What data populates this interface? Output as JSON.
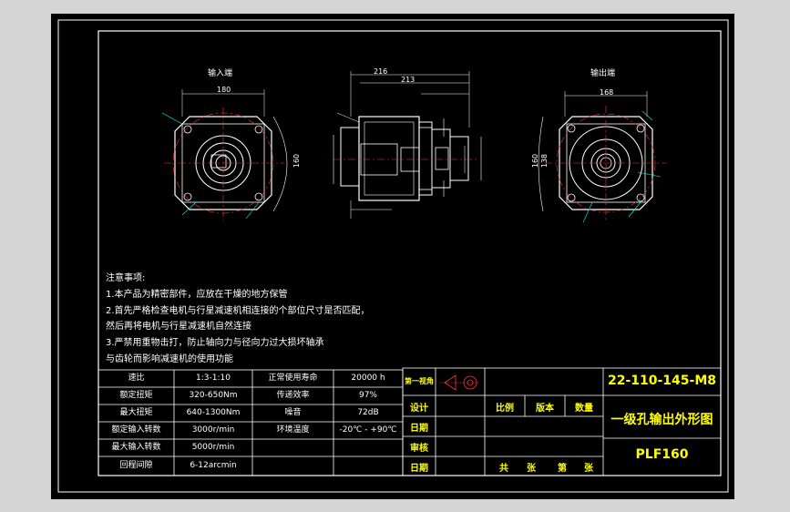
{
  "views": {
    "input_label": "输入端",
    "output_label": "输出端"
  },
  "dims": {
    "input_width": "180",
    "input_height": "160",
    "side_total_1": "216",
    "side_total_2": "213",
    "output_width": "168",
    "output_height": "160",
    "output_side": "138"
  },
  "notes": {
    "heading": "注意事项:",
    "line1": "1.本产品为精密部件，应放在干燥的地方保管",
    "line2": "2.首先严格检查电机与行星减速机相连接的个部位尺寸是否匹配，",
    "line3": "然后再将电机与行星减速机自然连接",
    "line4": "3.严禁用重物击打，防止轴向力与径向力过大损坏轴承",
    "line5": "与齿轮而影响减速机的使用功能"
  },
  "spec_table": [
    {
      "k1": "速比",
      "v1": "1:3-1:10",
      "k2": "正常使用寿命",
      "v2": "20000 h"
    },
    {
      "k1": "额定扭矩",
      "v1": "320-650Nm",
      "k2": "传递效率",
      "v2": "97%"
    },
    {
      "k1": "最大扭矩",
      "v1": "640-1300Nm",
      "k2": "噪音",
      "v2": "72dB"
    },
    {
      "k1": "额定输入转数",
      "v1": "3000r/min",
      "k2": "环境温度",
      "v2": "-20℃ - +90℃"
    },
    {
      "k1": "最大输入转数",
      "v1": "5000r/min",
      "k2": "",
      "v2": ""
    },
    {
      "k1": "回程间隙",
      "v1": "6-12arcmin",
      "k2": "",
      "v2": ""
    }
  ],
  "title_block": {
    "projection": "第一视角",
    "design": "设计",
    "date1": "日期",
    "review": "审核",
    "date2": "日期",
    "scale": "比例",
    "version": "版本",
    "quantity": "数量",
    "total": "共",
    "sheets": "张",
    "number": "第",
    "sheet": "张",
    "drawing_no": "22-110-145-M8",
    "drawing_title": "一级孔输出外形图",
    "model": "PLF160"
  }
}
